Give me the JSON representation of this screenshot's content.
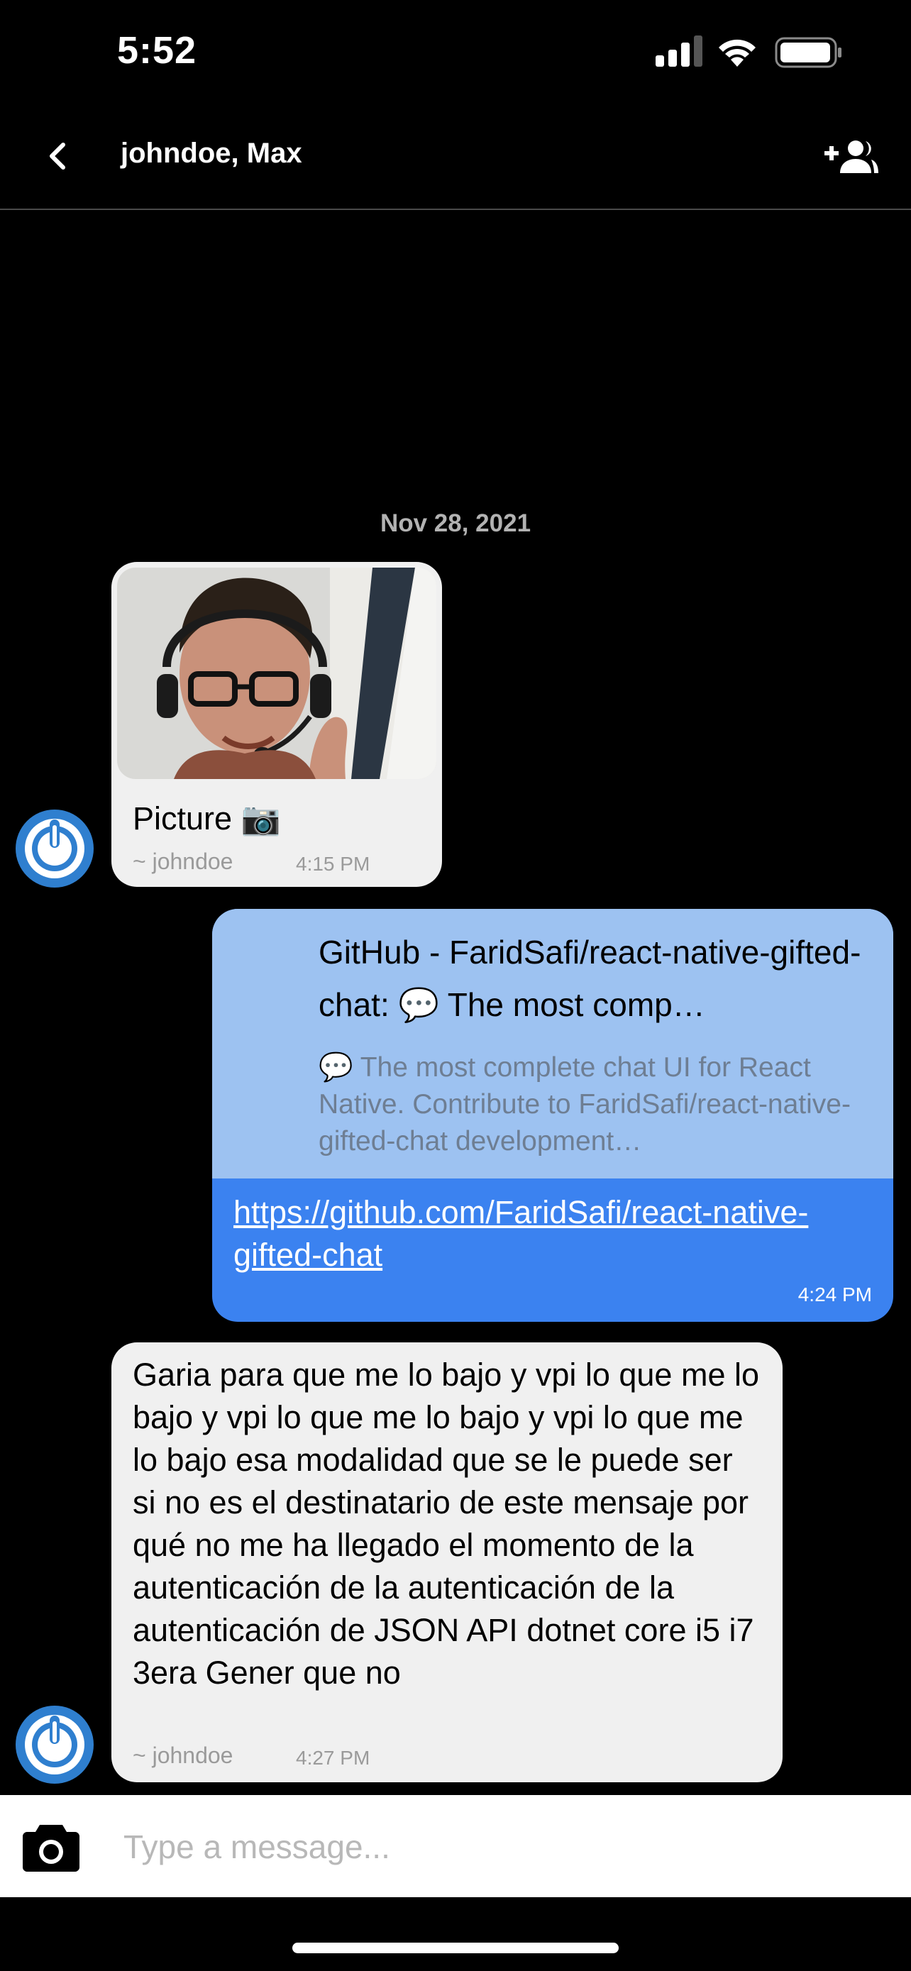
{
  "status_bar": {
    "time": "5:52",
    "icons": [
      "signal-icon",
      "wifi-icon",
      "battery-icon"
    ]
  },
  "nav": {
    "title": "johndoe, Max",
    "back_icon": "chevron-left-icon",
    "add_icon": "add-person-icon"
  },
  "date_separator": "Nov 28, 2021",
  "messages": [
    {
      "side": "left",
      "type": "image",
      "text": "Picture 📷",
      "user": "~ johndoe",
      "time": "4:15 PM"
    },
    {
      "side": "right",
      "type": "link",
      "preview_title": "GitHub - FaridSafi/react-native-gifted-chat: 💬 The most comp…",
      "preview_description": "💬 The most complete chat UI for React Native. Contribute to FaridSafi/react-native-gifted-chat development…",
      "url": "https://github.com/FaridSafi/react-native-gifted-chat",
      "time": "4:24 PM"
    },
    {
      "side": "left",
      "type": "text",
      "text": "Garia para que me lo bajo y vpi lo que me lo bajo y vpi lo que me lo bajo y vpi lo que me lo bajo esa modalidad que se le puede ser si no es el destinatario de este mensaje por qué no me ha llegado el momento de la autenticación de la autenticación de la autenticación de JSON API dotnet core i5 i7 3era Gener que no",
      "user": "~ johndoe",
      "time": "4:27 PM"
    }
  ],
  "composer": {
    "placeholder": "Type a message...",
    "camera_icon": "camera-icon"
  },
  "colors": {
    "background": "#000000",
    "received_bubble": "#f0f0f0",
    "sent_bubble": "#3b82f0",
    "link_preview": "#9dc2f1",
    "avatar": "#2f7fcf"
  }
}
